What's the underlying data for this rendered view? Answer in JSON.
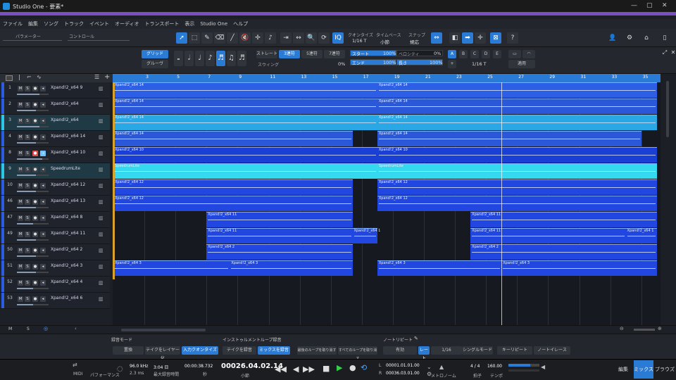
{
  "app": {
    "title": "Studio One - 要素*"
  },
  "menu": [
    "ファイル",
    "編集",
    "ソング",
    "トラック",
    "イベント",
    "オーディオ",
    "トランスポート",
    "表示",
    "Studio One",
    "ヘルプ"
  ],
  "toolbar": {
    "param_label": "パラメーター",
    "control_label": "コントロール",
    "quantize_label": "クオンタイズ",
    "quantize_value": "1/16 T",
    "timebase_label": "タイムベース",
    "timebase_value": "小節",
    "snap_label": "スナップ",
    "snap_value": "規応"
  },
  "editbar": {
    "grid": "グリッド",
    "groove": "グルーヴ",
    "straight": "ストレート",
    "triplet": "3連符",
    "quintuplet": "5連符",
    "septuplet": "7連符",
    "swing": "スウィング",
    "swing_value": "0%",
    "start": "スタート",
    "start_value": "100%",
    "end": "エンド",
    "end_value": "100%",
    "velocity": "ベロシティ",
    "velocity_value": "0%",
    "length": "長さ",
    "length_value": "100%",
    "letters": [
      "A",
      "B",
      "C",
      "D",
      "E"
    ],
    "plus": "+",
    "fraction": "1/16 T",
    "apply": "適用"
  },
  "tracks": [
    {
      "num": "1",
      "name": "Xpand!2_x64 9",
      "color": "#2a5de0",
      "vol": 0.7
    },
    {
      "num": "2",
      "name": "Xpand!2_x64",
      "color": "#2a5de0",
      "vol": 0.6
    },
    {
      "num": "3",
      "name": "Xpand!2_x64",
      "color": "#2cc7e6",
      "vol": 0.7
    },
    {
      "num": "4",
      "name": "Xpand!2_x64 14",
      "color": "#2a5de0",
      "vol": 0.6
    },
    {
      "num": "8",
      "name": "Xpand!2_x64 10",
      "color": "#2a5de0",
      "vol": 0.8,
      "rec": true
    },
    {
      "num": "9",
      "name": "SpeedrumLite",
      "color": "#2cc7e6",
      "vol": 0.6
    },
    {
      "num": "10",
      "name": "Xpand!2_x64 12",
      "color": "#2a5de0",
      "vol": 0.6
    },
    {
      "num": "46",
      "name": "Xpand!2_x64 13",
      "color": "#2a5de0",
      "vol": 0.6
    },
    {
      "num": "47",
      "name": "Xpand!2_x64 8",
      "color": "#2a5de0",
      "vol": 0.5
    },
    {
      "num": "49",
      "name": "Xpand!2_x64 11",
      "color": "#2a5de0",
      "vol": 0.6
    },
    {
      "num": "50",
      "name": "Xpand!2_x64 2",
      "color": "#2a5de0",
      "vol": 0.6
    },
    {
      "num": "51",
      "name": "Xpand!2_x64 3",
      "color": "#2a5de0",
      "vol": 0.6
    },
    {
      "num": "52",
      "name": "Xpand!2_x64 4",
      "color": "#2a5de0",
      "vol": 0.5
    },
    {
      "num": "53",
      "name": "Xpand!2_x64 6",
      "color": "#2a5de0",
      "vol": 0.5
    }
  ],
  "track_buttons": {
    "m": "M",
    "s": "S"
  },
  "ruler": [
    "3",
    "5",
    "7",
    "9",
    "11",
    "13",
    "15",
    "17",
    "19",
    "21",
    "23",
    "25",
    "27",
    "29",
    "31",
    "33",
    "35"
  ],
  "clips": [
    {
      "row": 0,
      "start": 0,
      "end": 17,
      "label": "Xpand!2_x64 14",
      "color": "#2c5ee6"
    },
    {
      "row": 0,
      "start": 17,
      "end": 35,
      "label": "Xpand!2_x64 14",
      "color": "#2c5ee6"
    },
    {
      "row": 1,
      "start": 0,
      "end": 17,
      "label": "Xpand!2_x64 14",
      "color": "#2b58d8"
    },
    {
      "row": 1,
      "start": 17,
      "end": 35,
      "label": "Xpand!2_x64 14",
      "color": "#2b58d8"
    },
    {
      "row": 2,
      "start": 0,
      "end": 17,
      "label": "Xpand!2_x64 14",
      "color": "#2aa8e6"
    },
    {
      "row": 2,
      "start": 17,
      "end": 35,
      "label": "Xpand!2_x64 14",
      "color": "#2aa8e6"
    },
    {
      "row": 3,
      "start": 0,
      "end": 15.4,
      "label": "Xpand!2_x64 14",
      "color": "#2b58d8"
    },
    {
      "row": 3,
      "start": 17,
      "end": 34,
      "label": "Xpand!2_x64 14",
      "color": "#2b58d8"
    },
    {
      "row": 4,
      "start": 0,
      "end": 17,
      "label": "Xpand!2_x64 10",
      "color": "#1a3fd4"
    },
    {
      "row": 4,
      "start": 17,
      "end": 35,
      "label": "Xpand!2_x64 10",
      "color": "#1a3fd4"
    },
    {
      "row": 5,
      "start": 0,
      "end": 17,
      "label": "SpeedrumLite",
      "color": "#34d8ef"
    },
    {
      "row": 5,
      "start": 17,
      "end": 35,
      "label": "SpeedrumLite",
      "color": "#34d8ef"
    },
    {
      "row": 6,
      "start": 0,
      "end": 15.4,
      "label": "Xpand!2_x64 12",
      "color": "#2246e0"
    },
    {
      "row": 6,
      "start": 17,
      "end": 35,
      "label": "Xpand!2_x64 12",
      "color": "#2246e0"
    },
    {
      "row": 7,
      "start": 0,
      "end": 15.4,
      "label": "Xpand!2_x64 12",
      "color": "#2246e0"
    },
    {
      "row": 7,
      "start": 17,
      "end": 35,
      "label": "Xpand!2_x64 12",
      "color": "#2246e0"
    },
    {
      "row": 8,
      "start": 6,
      "end": 15.4,
      "label": "Xpand!2_x64 11",
      "color": "#2246e0"
    },
    {
      "row": 8,
      "start": 23,
      "end": 35,
      "label": "Xpand!2_x64 11",
      "color": "#2246e0"
    },
    {
      "row": 9,
      "start": 6,
      "end": 15.4,
      "label": "Xpand!2_x64 11",
      "color": "#2246e0"
    },
    {
      "row": 9,
      "start": 15.4,
      "end": 17,
      "label": "Xpand!2_x64 1",
      "color": "#2246e0"
    },
    {
      "row": 9,
      "start": 23,
      "end": 33,
      "label": "Xpand!2_x64 11",
      "color": "#2246e0"
    },
    {
      "row": 9,
      "start": 33,
      "end": 35,
      "label": "Xpand!2_x64 1",
      "color": "#2246e0"
    },
    {
      "row": 10,
      "start": 6,
      "end": 15.4,
      "label": "Xpand!2_x64 2",
      "color": "#2246e0"
    },
    {
      "row": 10,
      "start": 23,
      "end": 35,
      "label": "Xpand!2_x64 2",
      "color": "#2246e0"
    },
    {
      "row": 11,
      "start": 0,
      "end": 7.5,
      "label": "Xpand!2_x64 3",
      "color": "#2246e0"
    },
    {
      "row": 11,
      "start": 7.5,
      "end": 15.4,
      "label": "Xpand!2_x64 3",
      "color": "#2246e0"
    },
    {
      "row": 11,
      "start": 17,
      "end": 25,
      "label": "Xpand!2_x64 3",
      "color": "#2246e0"
    },
    {
      "row": 11,
      "start": 25,
      "end": 35,
      "label": "Xpand!2_x64 3",
      "color": "#2246e0"
    }
  ],
  "bottom": {
    "rec_mode": "録音モード",
    "normal": "置換",
    "take_layer": "テイクをレイヤー化",
    "input_quantize": "入力クオンタイズ",
    "inst_loop": "インストゥルメントループ録音",
    "take_rec": "テイクを録音",
    "mix_rec": "ミックスを録音",
    "last_loop": "最後のループを取り消す",
    "all_loops": "すべてのループを取り消す",
    "note_repeat": "ノートリピート",
    "enable": "有効",
    "rate": "レート",
    "rate_value": "1/16",
    "single_mode": "シングルモード",
    "key_repeat": "キーリピート",
    "note_erase": "ノートイレース"
  },
  "transport": {
    "midi": "MIDI",
    "performance": "パフォーマンス",
    "sample_rate": "96.0 kHz",
    "latency": "2.3 ms",
    "rec_time": "3:04 日",
    "rec_time_label": "最大録音時間",
    "time": "00:00:38.732",
    "time_unit": "秒",
    "position": "00026.04.02.14",
    "position_unit": "小節",
    "loop_start": "00001.01.01.00",
    "loop_end": "00036.03.01.00",
    "metronome": "メトロノーム",
    "signature": "4 / 4",
    "sig_label": "拍子",
    "tempo": "160.00",
    "tempo_label": "テンポ"
  },
  "pages": {
    "edit": "編集",
    "mix": "ミックス",
    "browse": "ブラウズ"
  }
}
